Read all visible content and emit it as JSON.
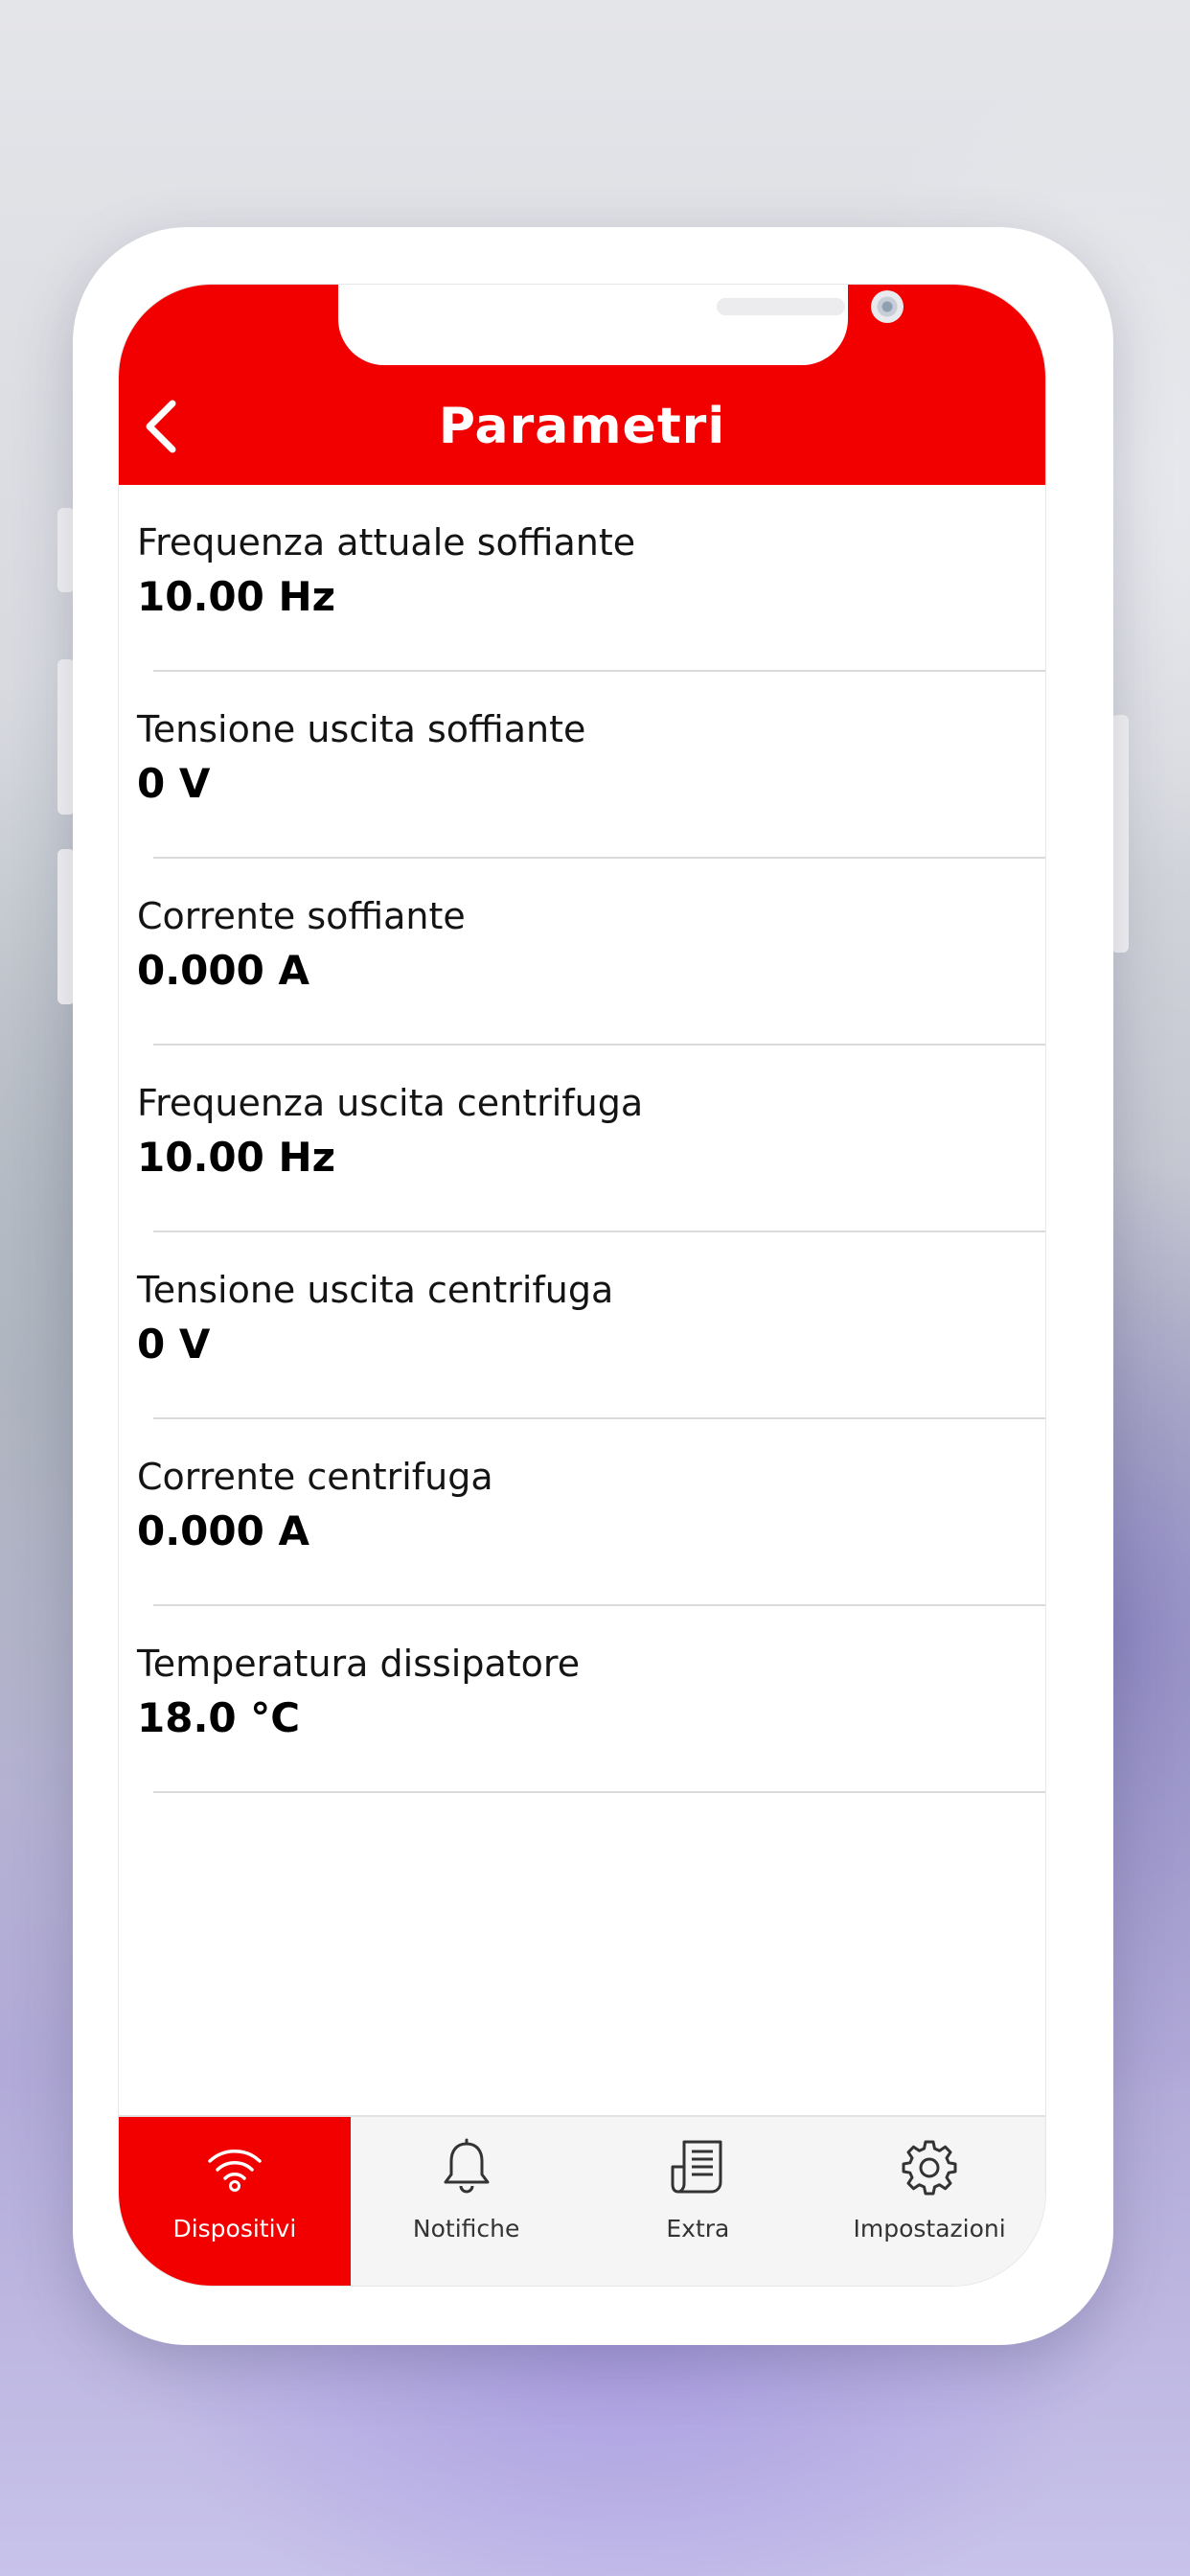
{
  "header": {
    "title": "Parametri",
    "back_icon": "chevron-left-icon",
    "accent_color": "#f20000"
  },
  "parameters": [
    {
      "label": "Frequenza attuale soffiante",
      "value": "10.00 Hz"
    },
    {
      "label": "Tensione uscita soffiante",
      "value": "0 V"
    },
    {
      "label": "Corrente soffiante",
      "value": "0.000 A"
    },
    {
      "label": "Frequenza uscita centrifuga",
      "value": "10.00 Hz"
    },
    {
      "label": "Tensione uscita centrifuga",
      "value": "0 V"
    },
    {
      "label": "Corrente centrifuga",
      "value": "0.000 A"
    },
    {
      "label": "Temperatura dissipatore",
      "value": "18.0 °C"
    }
  ],
  "tabs": [
    {
      "label": "Dispositivi",
      "icon": "wifi-icon",
      "active": true
    },
    {
      "label": "Notifiche",
      "icon": "bell-icon",
      "active": false
    },
    {
      "label": "Extra",
      "icon": "document-icon",
      "active": false
    },
    {
      "label": "Impostazioni",
      "icon": "gear-icon",
      "active": false
    }
  ]
}
